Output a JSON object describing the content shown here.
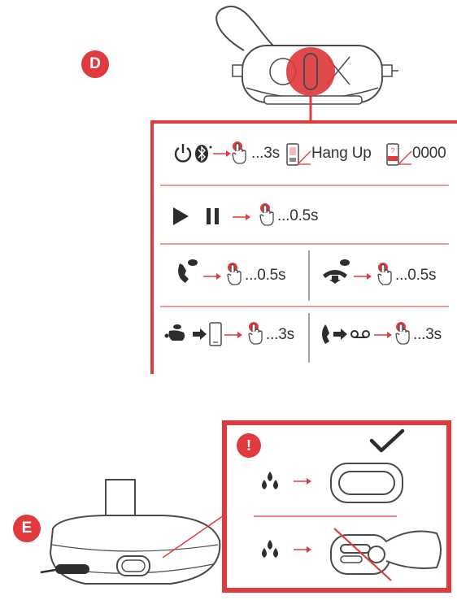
{
  "section_d": {
    "badge": "D",
    "rows": {
      "power_pair": {
        "duration": "...3s",
        "hang_up": "Hang Up",
        "code": "0000"
      },
      "play_pause": {
        "duration": "...0.5s"
      },
      "answer": {
        "duration": "...0.5s"
      },
      "reject": {
        "duration": "...0.5s"
      },
      "transfer": {
        "duration": "...3s"
      },
      "voicemail": {
        "duration": "...3s"
      }
    }
  },
  "section_e": {
    "badge": "E",
    "warning": "!"
  },
  "colors": {
    "accent": "#e03a3e",
    "line": "#4a4a4a"
  },
  "icons": [
    "power-icon",
    "bluetooth-icon",
    "press-finger-icon",
    "phone-icon",
    "play-icon",
    "pause-icon",
    "call-answer-icon",
    "call-reject-icon",
    "headset-icon",
    "voicemail-icon",
    "water-drops-icon",
    "check-icon"
  ]
}
